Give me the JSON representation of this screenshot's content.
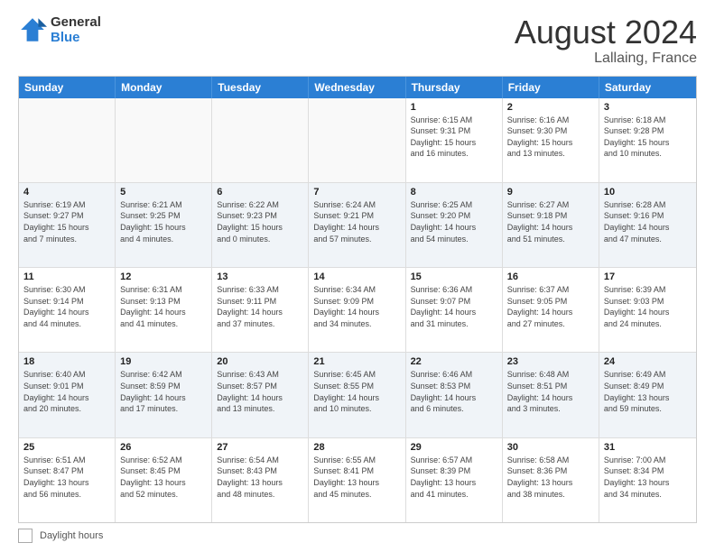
{
  "header": {
    "logo_line1": "General",
    "logo_line2": "Blue",
    "month_year": "August 2024",
    "location": "Lallaing, France"
  },
  "days_of_week": [
    "Sunday",
    "Monday",
    "Tuesday",
    "Wednesday",
    "Thursday",
    "Friday",
    "Saturday"
  ],
  "footer": {
    "label": "Daylight hours"
  },
  "weeks": [
    {
      "alt": false,
      "days": [
        {
          "num": "",
          "info": ""
        },
        {
          "num": "",
          "info": ""
        },
        {
          "num": "",
          "info": ""
        },
        {
          "num": "",
          "info": ""
        },
        {
          "num": "1",
          "info": "Sunrise: 6:15 AM\nSunset: 9:31 PM\nDaylight: 15 hours\nand 16 minutes."
        },
        {
          "num": "2",
          "info": "Sunrise: 6:16 AM\nSunset: 9:30 PM\nDaylight: 15 hours\nand 13 minutes."
        },
        {
          "num": "3",
          "info": "Sunrise: 6:18 AM\nSunset: 9:28 PM\nDaylight: 15 hours\nand 10 minutes."
        }
      ]
    },
    {
      "alt": true,
      "days": [
        {
          "num": "4",
          "info": "Sunrise: 6:19 AM\nSunset: 9:27 PM\nDaylight: 15 hours\nand 7 minutes."
        },
        {
          "num": "5",
          "info": "Sunrise: 6:21 AM\nSunset: 9:25 PM\nDaylight: 15 hours\nand 4 minutes."
        },
        {
          "num": "6",
          "info": "Sunrise: 6:22 AM\nSunset: 9:23 PM\nDaylight: 15 hours\nand 0 minutes."
        },
        {
          "num": "7",
          "info": "Sunrise: 6:24 AM\nSunset: 9:21 PM\nDaylight: 14 hours\nand 57 minutes."
        },
        {
          "num": "8",
          "info": "Sunrise: 6:25 AM\nSunset: 9:20 PM\nDaylight: 14 hours\nand 54 minutes."
        },
        {
          "num": "9",
          "info": "Sunrise: 6:27 AM\nSunset: 9:18 PM\nDaylight: 14 hours\nand 51 minutes."
        },
        {
          "num": "10",
          "info": "Sunrise: 6:28 AM\nSunset: 9:16 PM\nDaylight: 14 hours\nand 47 minutes."
        }
      ]
    },
    {
      "alt": false,
      "days": [
        {
          "num": "11",
          "info": "Sunrise: 6:30 AM\nSunset: 9:14 PM\nDaylight: 14 hours\nand 44 minutes."
        },
        {
          "num": "12",
          "info": "Sunrise: 6:31 AM\nSunset: 9:13 PM\nDaylight: 14 hours\nand 41 minutes."
        },
        {
          "num": "13",
          "info": "Sunrise: 6:33 AM\nSunset: 9:11 PM\nDaylight: 14 hours\nand 37 minutes."
        },
        {
          "num": "14",
          "info": "Sunrise: 6:34 AM\nSunset: 9:09 PM\nDaylight: 14 hours\nand 34 minutes."
        },
        {
          "num": "15",
          "info": "Sunrise: 6:36 AM\nSunset: 9:07 PM\nDaylight: 14 hours\nand 31 minutes."
        },
        {
          "num": "16",
          "info": "Sunrise: 6:37 AM\nSunset: 9:05 PM\nDaylight: 14 hours\nand 27 minutes."
        },
        {
          "num": "17",
          "info": "Sunrise: 6:39 AM\nSunset: 9:03 PM\nDaylight: 14 hours\nand 24 minutes."
        }
      ]
    },
    {
      "alt": true,
      "days": [
        {
          "num": "18",
          "info": "Sunrise: 6:40 AM\nSunset: 9:01 PM\nDaylight: 14 hours\nand 20 minutes."
        },
        {
          "num": "19",
          "info": "Sunrise: 6:42 AM\nSunset: 8:59 PM\nDaylight: 14 hours\nand 17 minutes."
        },
        {
          "num": "20",
          "info": "Sunrise: 6:43 AM\nSunset: 8:57 PM\nDaylight: 14 hours\nand 13 minutes."
        },
        {
          "num": "21",
          "info": "Sunrise: 6:45 AM\nSunset: 8:55 PM\nDaylight: 14 hours\nand 10 minutes."
        },
        {
          "num": "22",
          "info": "Sunrise: 6:46 AM\nSunset: 8:53 PM\nDaylight: 14 hours\nand 6 minutes."
        },
        {
          "num": "23",
          "info": "Sunrise: 6:48 AM\nSunset: 8:51 PM\nDaylight: 14 hours\nand 3 minutes."
        },
        {
          "num": "24",
          "info": "Sunrise: 6:49 AM\nSunset: 8:49 PM\nDaylight: 13 hours\nand 59 minutes."
        }
      ]
    },
    {
      "alt": false,
      "days": [
        {
          "num": "25",
          "info": "Sunrise: 6:51 AM\nSunset: 8:47 PM\nDaylight: 13 hours\nand 56 minutes."
        },
        {
          "num": "26",
          "info": "Sunrise: 6:52 AM\nSunset: 8:45 PM\nDaylight: 13 hours\nand 52 minutes."
        },
        {
          "num": "27",
          "info": "Sunrise: 6:54 AM\nSunset: 8:43 PM\nDaylight: 13 hours\nand 48 minutes."
        },
        {
          "num": "28",
          "info": "Sunrise: 6:55 AM\nSunset: 8:41 PM\nDaylight: 13 hours\nand 45 minutes."
        },
        {
          "num": "29",
          "info": "Sunrise: 6:57 AM\nSunset: 8:39 PM\nDaylight: 13 hours\nand 41 minutes."
        },
        {
          "num": "30",
          "info": "Sunrise: 6:58 AM\nSunset: 8:36 PM\nDaylight: 13 hours\nand 38 minutes."
        },
        {
          "num": "31",
          "info": "Sunrise: 7:00 AM\nSunset: 8:34 PM\nDaylight: 13 hours\nand 34 minutes."
        }
      ]
    }
  ]
}
